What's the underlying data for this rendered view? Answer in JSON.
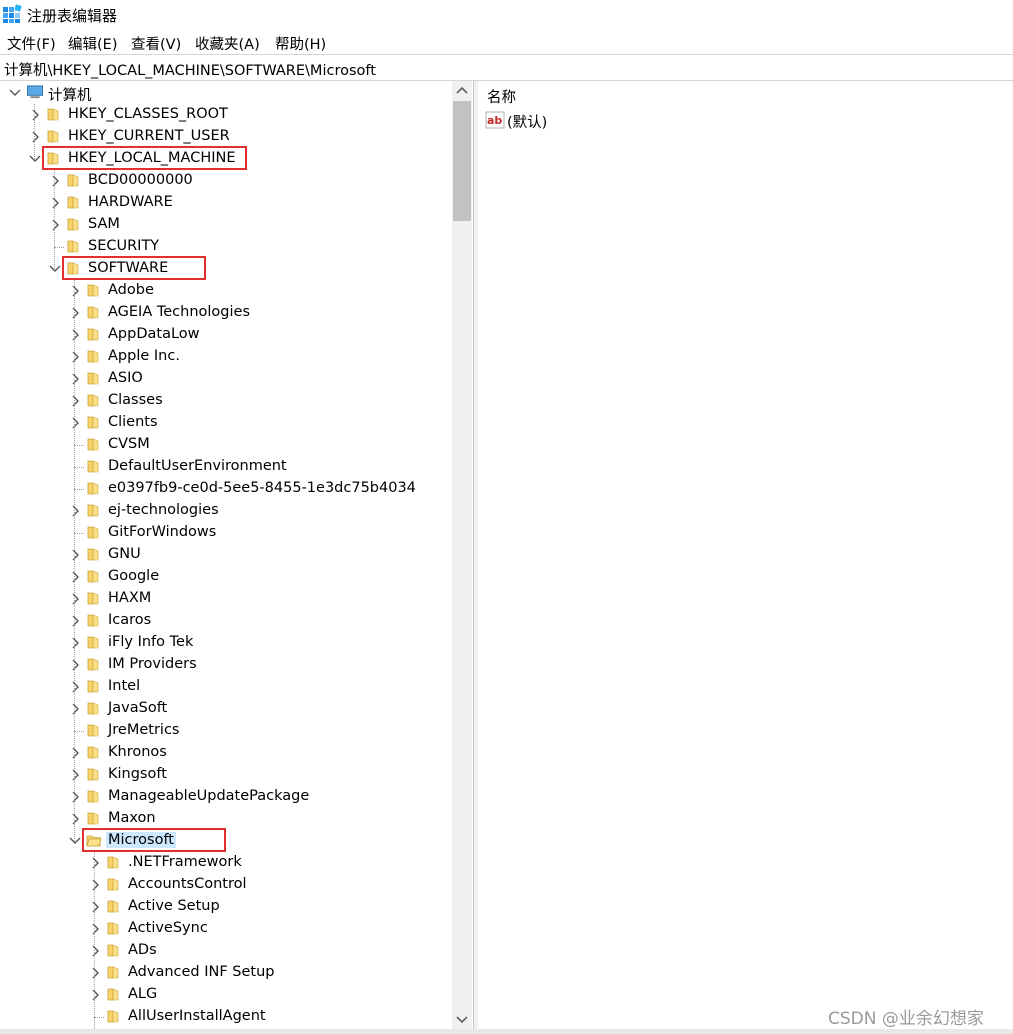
{
  "window": {
    "title": "注册表编辑器"
  },
  "menu": [
    "文件(F)",
    "编辑(E)",
    "查看(V)",
    "收藏夹(A)",
    "帮助(H)"
  ],
  "address": "计算机\\HKEY_LOCAL_MACHINE\\SOFTWARE\\Microsoft",
  "tree": [
    {
      "label": "计算机",
      "level": 0,
      "arrow": "down",
      "icon": "computer-icon"
    },
    {
      "label": "HKEY_CLASSES_ROOT",
      "level": 1,
      "arrow": "right",
      "icon": "folder-icon"
    },
    {
      "label": "HKEY_CURRENT_USER",
      "level": 1,
      "arrow": "right",
      "icon": "folder-icon"
    },
    {
      "label": "HKEY_LOCAL_MACHINE",
      "level": 1,
      "arrow": "down",
      "icon": "folder-icon",
      "highlight": true
    },
    {
      "label": "BCD00000000",
      "level": 2,
      "arrow": "right",
      "icon": "folder-icon"
    },
    {
      "label": "HARDWARE",
      "level": 2,
      "arrow": "right",
      "icon": "folder-icon"
    },
    {
      "label": "SAM",
      "level": 2,
      "arrow": "right",
      "icon": "folder-icon"
    },
    {
      "label": "SECURITY",
      "level": 2,
      "arrow": "none",
      "icon": "folder-icon"
    },
    {
      "label": "SOFTWARE",
      "level": 2,
      "arrow": "down",
      "icon": "folder-icon",
      "highlight": true
    },
    {
      "label": "Adobe",
      "level": 3,
      "arrow": "right",
      "icon": "folder-icon"
    },
    {
      "label": "AGEIA Technologies",
      "level": 3,
      "arrow": "right",
      "icon": "folder-icon"
    },
    {
      "label": "AppDataLow",
      "level": 3,
      "arrow": "right",
      "icon": "folder-icon"
    },
    {
      "label": "Apple Inc.",
      "level": 3,
      "arrow": "right",
      "icon": "folder-icon"
    },
    {
      "label": "ASIO",
      "level": 3,
      "arrow": "right",
      "icon": "folder-icon"
    },
    {
      "label": "Classes",
      "level": 3,
      "arrow": "right",
      "icon": "folder-icon"
    },
    {
      "label": "Clients",
      "level": 3,
      "arrow": "right",
      "icon": "folder-icon"
    },
    {
      "label": "CVSM",
      "level": 3,
      "arrow": "none",
      "icon": "folder-icon"
    },
    {
      "label": "DefaultUserEnvironment",
      "level": 3,
      "arrow": "none",
      "icon": "folder-icon"
    },
    {
      "label": "e0397fb9-ce0d-5ee5-8455-1e3dc75b4034",
      "level": 3,
      "arrow": "none",
      "icon": "folder-icon"
    },
    {
      "label": "ej-technologies",
      "level": 3,
      "arrow": "right",
      "icon": "folder-icon"
    },
    {
      "label": "GitForWindows",
      "level": 3,
      "arrow": "none",
      "icon": "folder-icon"
    },
    {
      "label": "GNU",
      "level": 3,
      "arrow": "right",
      "icon": "folder-icon"
    },
    {
      "label": "Google",
      "level": 3,
      "arrow": "right",
      "icon": "folder-icon"
    },
    {
      "label": "HAXM",
      "level": 3,
      "arrow": "right",
      "icon": "folder-icon"
    },
    {
      "label": "Icaros",
      "level": 3,
      "arrow": "right",
      "icon": "folder-icon"
    },
    {
      "label": "iFly Info Tek",
      "level": 3,
      "arrow": "right",
      "icon": "folder-icon"
    },
    {
      "label": "IM Providers",
      "level": 3,
      "arrow": "right",
      "icon": "folder-icon"
    },
    {
      "label": "Intel",
      "level": 3,
      "arrow": "right",
      "icon": "folder-icon"
    },
    {
      "label": "JavaSoft",
      "level": 3,
      "arrow": "right",
      "icon": "folder-icon"
    },
    {
      "label": "JreMetrics",
      "level": 3,
      "arrow": "none",
      "icon": "folder-icon"
    },
    {
      "label": "Khronos",
      "level": 3,
      "arrow": "right",
      "icon": "folder-icon"
    },
    {
      "label": "Kingsoft",
      "level": 3,
      "arrow": "right",
      "icon": "folder-icon"
    },
    {
      "label": "ManageableUpdatePackage",
      "level": 3,
      "arrow": "right",
      "icon": "folder-icon"
    },
    {
      "label": "Maxon",
      "level": 3,
      "arrow": "right",
      "icon": "folder-icon"
    },
    {
      "label": "Microsoft",
      "level": 3,
      "arrow": "down",
      "icon": "folder-open-icon",
      "highlight": true,
      "selected": true
    },
    {
      "label": ".NETFramework",
      "level": 4,
      "arrow": "right",
      "icon": "folder-icon"
    },
    {
      "label": "AccountsControl",
      "level": 4,
      "arrow": "right",
      "icon": "folder-icon"
    },
    {
      "label": "Active Setup",
      "level": 4,
      "arrow": "right",
      "icon": "folder-icon"
    },
    {
      "label": "ActiveSync",
      "level": 4,
      "arrow": "right",
      "icon": "folder-icon"
    },
    {
      "label": "ADs",
      "level": 4,
      "arrow": "right",
      "icon": "folder-icon"
    },
    {
      "label": "Advanced INF Setup",
      "level": 4,
      "arrow": "right",
      "icon": "folder-icon"
    },
    {
      "label": "ALG",
      "level": 4,
      "arrow": "right",
      "icon": "folder-icon"
    },
    {
      "label": "AllUserInstallAgent",
      "level": 4,
      "arrow": "none",
      "icon": "folder-icon"
    }
  ],
  "values_pane": {
    "header": "名称",
    "rows": [
      {
        "name": "(默认)",
        "icon": "string-value-icon"
      }
    ]
  },
  "watermark": "CSDN @业余幻想家",
  "colors": {
    "highlight_box": "#e03030",
    "selection": "#cce8ff",
    "folder": "#f8d26a"
  }
}
